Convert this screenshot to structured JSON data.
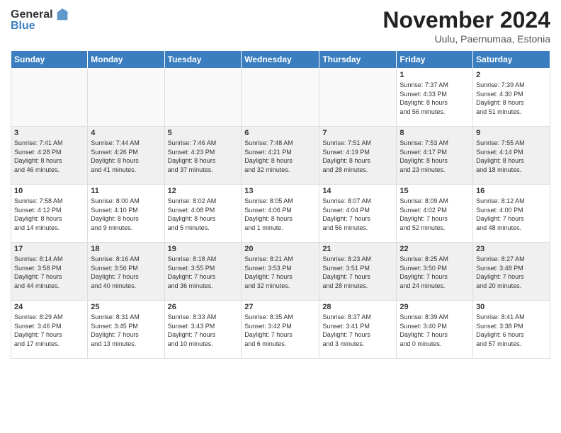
{
  "header": {
    "logo": {
      "general": "General",
      "blue": "Blue"
    },
    "title": "November 2024",
    "subtitle": "Uulu, Paernumaa, Estonia"
  },
  "calendar": {
    "days_of_week": [
      "Sunday",
      "Monday",
      "Tuesday",
      "Wednesday",
      "Thursday",
      "Friday",
      "Saturday"
    ],
    "weeks": [
      [
        {
          "day": "",
          "info": ""
        },
        {
          "day": "",
          "info": ""
        },
        {
          "day": "",
          "info": ""
        },
        {
          "day": "",
          "info": ""
        },
        {
          "day": "",
          "info": ""
        },
        {
          "day": "1",
          "info": "Sunrise: 7:37 AM\nSunset: 4:33 PM\nDaylight: 8 hours\nand 56 minutes."
        },
        {
          "day": "2",
          "info": "Sunrise: 7:39 AM\nSunset: 4:30 PM\nDaylight: 8 hours\nand 51 minutes."
        }
      ],
      [
        {
          "day": "3",
          "info": "Sunrise: 7:41 AM\nSunset: 4:28 PM\nDaylight: 8 hours\nand 46 minutes."
        },
        {
          "day": "4",
          "info": "Sunrise: 7:44 AM\nSunset: 4:26 PM\nDaylight: 8 hours\nand 41 minutes."
        },
        {
          "day": "5",
          "info": "Sunrise: 7:46 AM\nSunset: 4:23 PM\nDaylight: 8 hours\nand 37 minutes."
        },
        {
          "day": "6",
          "info": "Sunrise: 7:48 AM\nSunset: 4:21 PM\nDaylight: 8 hours\nand 32 minutes."
        },
        {
          "day": "7",
          "info": "Sunrise: 7:51 AM\nSunset: 4:19 PM\nDaylight: 8 hours\nand 28 minutes."
        },
        {
          "day": "8",
          "info": "Sunrise: 7:53 AM\nSunset: 4:17 PM\nDaylight: 8 hours\nand 23 minutes."
        },
        {
          "day": "9",
          "info": "Sunrise: 7:55 AM\nSunset: 4:14 PM\nDaylight: 8 hours\nand 18 minutes."
        }
      ],
      [
        {
          "day": "10",
          "info": "Sunrise: 7:58 AM\nSunset: 4:12 PM\nDaylight: 8 hours\nand 14 minutes."
        },
        {
          "day": "11",
          "info": "Sunrise: 8:00 AM\nSunset: 4:10 PM\nDaylight: 8 hours\nand 9 minutes."
        },
        {
          "day": "12",
          "info": "Sunrise: 8:02 AM\nSunset: 4:08 PM\nDaylight: 8 hours\nand 5 minutes."
        },
        {
          "day": "13",
          "info": "Sunrise: 8:05 AM\nSunset: 4:06 PM\nDaylight: 8 hours\nand 1 minute."
        },
        {
          "day": "14",
          "info": "Sunrise: 8:07 AM\nSunset: 4:04 PM\nDaylight: 7 hours\nand 56 minutes."
        },
        {
          "day": "15",
          "info": "Sunrise: 8:09 AM\nSunset: 4:02 PM\nDaylight: 7 hours\nand 52 minutes."
        },
        {
          "day": "16",
          "info": "Sunrise: 8:12 AM\nSunset: 4:00 PM\nDaylight: 7 hours\nand 48 minutes."
        }
      ],
      [
        {
          "day": "17",
          "info": "Sunrise: 8:14 AM\nSunset: 3:58 PM\nDaylight: 7 hours\nand 44 minutes."
        },
        {
          "day": "18",
          "info": "Sunrise: 8:16 AM\nSunset: 3:56 PM\nDaylight: 7 hours\nand 40 minutes."
        },
        {
          "day": "19",
          "info": "Sunrise: 8:18 AM\nSunset: 3:55 PM\nDaylight: 7 hours\nand 36 minutes."
        },
        {
          "day": "20",
          "info": "Sunrise: 8:21 AM\nSunset: 3:53 PM\nDaylight: 7 hours\nand 32 minutes."
        },
        {
          "day": "21",
          "info": "Sunrise: 8:23 AM\nSunset: 3:51 PM\nDaylight: 7 hours\nand 28 minutes."
        },
        {
          "day": "22",
          "info": "Sunrise: 8:25 AM\nSunset: 3:50 PM\nDaylight: 7 hours\nand 24 minutes."
        },
        {
          "day": "23",
          "info": "Sunrise: 8:27 AM\nSunset: 3:48 PM\nDaylight: 7 hours\nand 20 minutes."
        }
      ],
      [
        {
          "day": "24",
          "info": "Sunrise: 8:29 AM\nSunset: 3:46 PM\nDaylight: 7 hours\nand 17 minutes."
        },
        {
          "day": "25",
          "info": "Sunrise: 8:31 AM\nSunset: 3:45 PM\nDaylight: 7 hours\nand 13 minutes."
        },
        {
          "day": "26",
          "info": "Sunrise: 8:33 AM\nSunset: 3:43 PM\nDaylight: 7 hours\nand 10 minutes."
        },
        {
          "day": "27",
          "info": "Sunrise: 8:35 AM\nSunset: 3:42 PM\nDaylight: 7 hours\nand 6 minutes."
        },
        {
          "day": "28",
          "info": "Sunrise: 8:37 AM\nSunset: 3:41 PM\nDaylight: 7 hours\nand 3 minutes."
        },
        {
          "day": "29",
          "info": "Sunrise: 8:39 AM\nSunset: 3:40 PM\nDaylight: 7 hours\nand 0 minutes."
        },
        {
          "day": "30",
          "info": "Sunrise: 8:41 AM\nSunset: 3:38 PM\nDaylight: 6 hours\nand 57 minutes."
        }
      ]
    ]
  }
}
